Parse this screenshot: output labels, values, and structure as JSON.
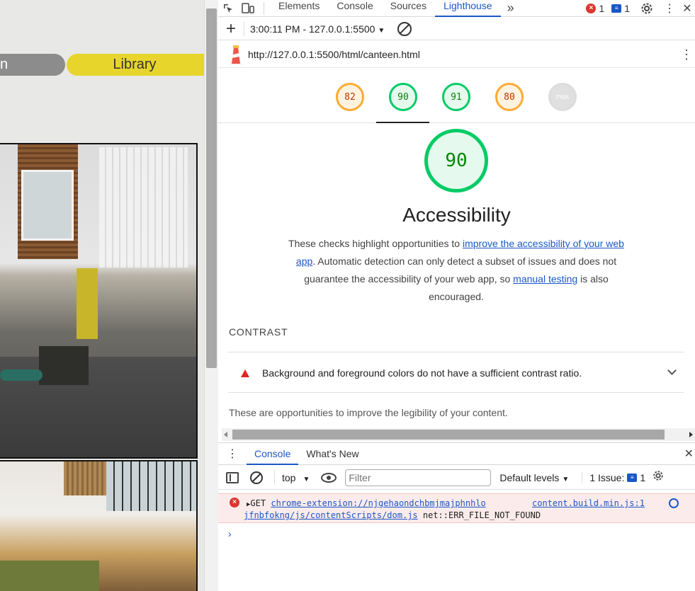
{
  "page": {
    "nav_left_label": "n",
    "nav_library_label": "Library"
  },
  "devtools": {
    "tabs": [
      {
        "label": "Elements"
      },
      {
        "label": "Console"
      },
      {
        "label": "Sources"
      },
      {
        "label": "Lighthouse"
      }
    ],
    "more_tabs": "»",
    "error_count": "1",
    "message_count": "1",
    "lighthouse": {
      "run_label": "3:00:11 PM - 127.0.0.1:5500",
      "url": "http://127.0.0.1:5500/html/canteen.html",
      "scores": [
        "82",
        "90",
        "91",
        "80"
      ],
      "pwa_label": "PWA",
      "active_score": "90",
      "category_title": "Accessibility",
      "desc_part1": "These checks highlight opportunities to ",
      "desc_link1": "improve the accessibility of your web app",
      "desc_part2": ". Automatic detection can only detect a subset of issues and does not guarantee the accessibility of your web app, so ",
      "desc_link2": "manual testing",
      "desc_part3": " is also encouraged.",
      "group_title": "CONTRAST",
      "audit_title": "Background and foreground colors do not have a sufficient contrast ratio.",
      "group_footnote": "These are opportunities to improve the legibility of your content."
    },
    "drawer": {
      "tabs": [
        {
          "label": "Console"
        },
        {
          "label": "What's New"
        }
      ],
      "context": "top",
      "filter_placeholder": "Filter",
      "levels": "Default levels",
      "issues_label": "1 Issue:",
      "issues_count": "1"
    },
    "console_error": {
      "method": "GET",
      "url_part1": "chrome-extension://njgehaondchbmjmajphnhlo",
      "url_part2": "jfnbfokng/js/contentScripts/dom.js",
      "message": "net::ERR_FILE_NOT_FOUND",
      "source": "content.build.min.js:1"
    },
    "prompt": "›"
  }
}
